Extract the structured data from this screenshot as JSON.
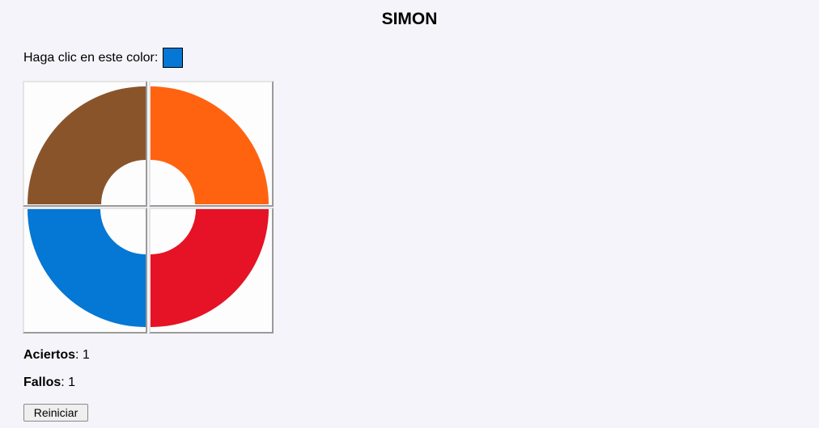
{
  "game": {
    "title": "SIMON",
    "prompt_label": "Haga clic en este color:",
    "target_color": "#0577d4"
  },
  "board": {
    "quadrants": [
      {
        "id": "top-left",
        "color": "#8a542b"
      },
      {
        "id": "top-right",
        "color": "#ff6310"
      },
      {
        "id": "bottom-left",
        "color": "#0577d4"
      },
      {
        "id": "bottom-right",
        "color": "#e51325"
      }
    ]
  },
  "score": {
    "hits_label": "Aciertos",
    "hits_value": ": 1",
    "misses_label": "Fallos",
    "misses_value": ": 1"
  },
  "controls": {
    "restart_label": "Reiniciar"
  }
}
